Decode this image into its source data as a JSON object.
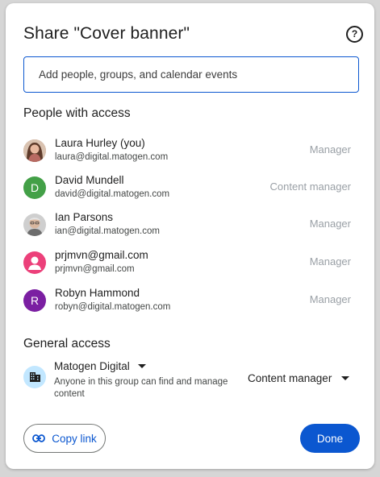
{
  "dialog": {
    "title": "Share \"Cover banner\"",
    "help_icon": "help-circle-icon",
    "add_placeholder": "Add people, groups, and calendar events"
  },
  "people_section": {
    "title": "People with access",
    "people": [
      {
        "name": "Laura Hurley (you)",
        "email": "laura@digital.matogen.com",
        "role": "Manager",
        "avatar": "photo",
        "avatar_color": "#8d6e63",
        "initial": ""
      },
      {
        "name": "David Mundell",
        "email": "david@digital.matogen.com",
        "role": "Content manager",
        "avatar": "initial",
        "avatar_color": "#43a047",
        "initial": "D"
      },
      {
        "name": "Ian Parsons",
        "email": "ian@digital.matogen.com",
        "role": "Manager",
        "avatar": "photo",
        "avatar_color": "#9e9e9e",
        "initial": ""
      },
      {
        "name": "prjmvn@gmail.com",
        "email": "prjmvn@gmail.com",
        "role": "Manager",
        "avatar": "person-icon",
        "avatar_color": "#ec407a",
        "initial": ""
      },
      {
        "name": "Robyn Hammond",
        "email": "robyn@digital.matogen.com",
        "role": "Manager",
        "avatar": "initial",
        "avatar_color": "#7b1fa2",
        "initial": "R"
      }
    ]
  },
  "general_access": {
    "title": "General access",
    "icon": "building-icon",
    "group": "Matogen Digital",
    "description": "Anyone in this group can find and manage content",
    "role": "Content manager"
  },
  "footer": {
    "copy_link_label": "Copy link",
    "copy_link_icon": "link-icon",
    "done_label": "Done"
  },
  "colors": {
    "accent": "#0b57d0",
    "muted_role": "#9aa0a6"
  }
}
